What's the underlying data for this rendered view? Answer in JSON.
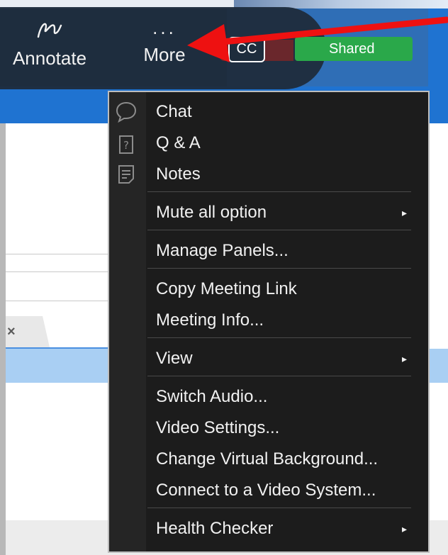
{
  "toolbar": {
    "annotate_label": "Annotate",
    "more_dots": "...",
    "more_label": "More",
    "cc_label": "CC",
    "shared_label": "Shared"
  },
  "tab": {
    "close_glyph": "×"
  },
  "menu": {
    "chat": "Chat",
    "qa": "Q & A",
    "notes": "Notes",
    "mute_all": "Mute all option",
    "manage_panels": "Manage Panels...",
    "copy_link": "Copy Meeting Link",
    "meeting_info": "Meeting Info...",
    "view": "View",
    "switch_audio": "Switch Audio...",
    "video_settings": "Video Settings...",
    "virtual_background": "Change Virtual Background...",
    "video_system": "Connect to a Video System...",
    "health_checker": "Health Checker"
  },
  "colors": {
    "menu_bg": "#1c1c1c",
    "toolbar_bg": "#1e2d3d",
    "shared_green": "#2aa84a",
    "arrow_red": "#ee1111",
    "accent_blue": "#1f73d1"
  }
}
